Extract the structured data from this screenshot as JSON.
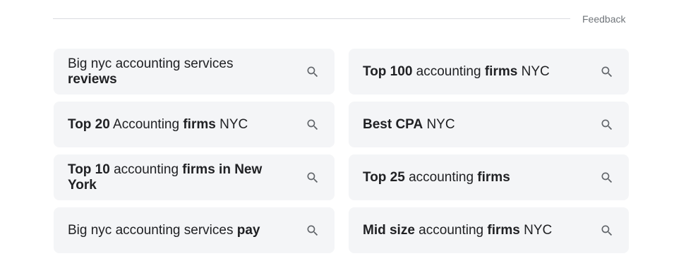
{
  "feedback_label": "Feedback",
  "suggestions": [
    {
      "parts": [
        {
          "t": "Big nyc accounting services "
        },
        {
          "t": "reviews",
          "b": true
        }
      ]
    },
    {
      "parts": [
        {
          "t": "Top 100",
          "b": true
        },
        {
          "t": " accounting "
        },
        {
          "t": "firms",
          "b": true
        },
        {
          "t": " NYC"
        }
      ]
    },
    {
      "parts": [
        {
          "t": "Top 20",
          "b": true
        },
        {
          "t": " Accounting "
        },
        {
          "t": "firms",
          "b": true
        },
        {
          "t": " NYC"
        }
      ]
    },
    {
      "parts": [
        {
          "t": "Best CPA",
          "b": true
        },
        {
          "t": " NYC"
        }
      ]
    },
    {
      "parts": [
        {
          "t": "Top 10",
          "b": true
        },
        {
          "t": " accounting "
        },
        {
          "t": "firms in New York",
          "b": true
        }
      ]
    },
    {
      "parts": [
        {
          "t": "Top 25",
          "b": true
        },
        {
          "t": " accounting "
        },
        {
          "t": "firms",
          "b": true
        }
      ]
    },
    {
      "parts": [
        {
          "t": "Big nyc accounting services "
        },
        {
          "t": "pay",
          "b": true
        }
      ]
    },
    {
      "parts": [
        {
          "t": "Mid size",
          "b": true
        },
        {
          "t": " accounting "
        },
        {
          "t": "firms",
          "b": true
        },
        {
          "t": " NYC"
        }
      ]
    }
  ],
  "icon": "search-icon",
  "colors": {
    "chip_bg": "#f4f5f7",
    "text": "#202124",
    "icon": "#5f6368",
    "divider": "#dadce0",
    "feedback": "#70757a"
  }
}
